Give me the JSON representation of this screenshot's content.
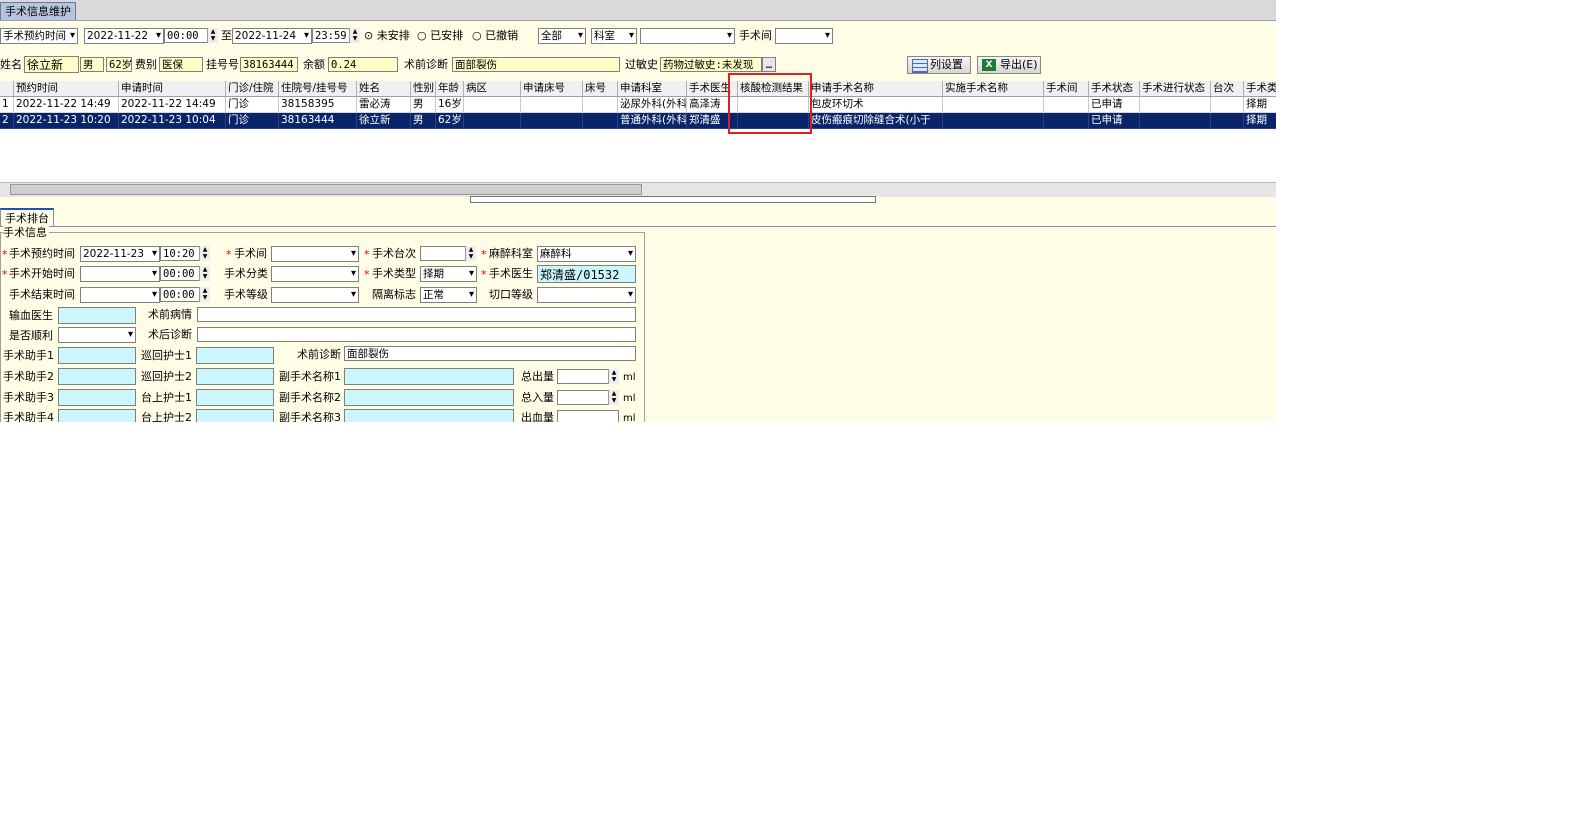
{
  "window": {
    "tab_title": "手术信息维护"
  },
  "filter": {
    "date_type": "手术预约时间",
    "start_date": "2022-11-22",
    "start_time": "00:00",
    "to_label": "至",
    "end_date": "2022-11-24",
    "end_time": "23:59",
    "radio_unscheduled": "未安排",
    "radio_scheduled": "已安排",
    "radio_cancelled": "已撤销",
    "scope": "全部",
    "dept_type": "科室",
    "dept_value": "",
    "room_label": "手术间",
    "room_value": ""
  },
  "patient": {
    "name_label": "姓名",
    "name": "徐立新",
    "gender": "男",
    "age": "62岁",
    "fee_type_label": "费别",
    "fee_type": "医保",
    "reg_no_label": "挂号号",
    "reg_no": "38163444",
    "balance_label": "余额",
    "balance": "0.24",
    "preop_dx_label": "术前诊断",
    "preop_dx": "面部裂伤",
    "allergy_label": "过敏史",
    "allergy": "药物过敏史:未发现"
  },
  "toolbar": {
    "columns_btn": "列设置",
    "export_btn": "导出(E)"
  },
  "grid": {
    "columns": [
      "预约时间",
      "申请时间",
      "门诊/住院",
      "住院号/挂号号",
      "姓名",
      "性别",
      "年龄",
      "病区",
      "申请床号",
      "床号",
      "申请科室",
      "手术医生",
      "核酸检测结果",
      "申请手术名称",
      "实施手术名称",
      "手术间",
      "手术状态",
      "手术进行状态",
      "台次",
      "手术类"
    ],
    "rows": [
      {
        "no": "1",
        "cells": [
          "2022-11-22 14:49",
          "2022-11-22 14:49",
          "门诊",
          "38158395",
          "雷必涛",
          "男",
          "16岁",
          "",
          "",
          "",
          "泌尿外科(外科",
          "高泽涛",
          "",
          "包皮环切术",
          "",
          "",
          "已申请",
          "",
          "",
          "择期"
        ]
      },
      {
        "no": "2",
        "cells": [
          "2022-11-23 10:20",
          "2022-11-23 10:04",
          "门诊",
          "38163444",
          "徐立新",
          "男",
          "62岁",
          "",
          "",
          "",
          "普通外科(外科",
          "郑清盛",
          "",
          "皮伤瘢痕切除缝合术(小于",
          "",
          "",
          "已申请",
          "",
          "",
          "择期"
        ]
      }
    ]
  },
  "detail": {
    "tab": "手术排台",
    "group": "手术信息",
    "appt_time_label": "手术预约时间",
    "appt_date": "2022-11-23",
    "appt_time": "10:20",
    "room_label": "手术间",
    "room": "",
    "seq_label": "手术台次",
    "seq": "",
    "anes_dept_label": "麻醉科室",
    "anes_dept": "麻醉科",
    "start_time_label": "手术开始时间",
    "start_date": "",
    "start_time": "00:00",
    "category_label": "手术分类",
    "category": "",
    "type_label": "手术类型",
    "type": "择期",
    "surgeon_label": "手术医生",
    "surgeon": "郑清盛/01532",
    "end_time_label": "手术结束时间",
    "end_date": "",
    "end_time": "00:00",
    "grade_label": "手术等级",
    "grade": "",
    "isolation_label": "隔离标志",
    "isolation": "正常",
    "incision_label": "切口等级",
    "incision": "",
    "transfusion_doc_label": "输血医生",
    "preop_condition_label": "术前病情",
    "smooth_label": "是否顺利",
    "postop_dx_label": "术后诊断",
    "assist1_label": "手术助手1",
    "circ_nurse1_label": "巡回护士1",
    "preop_dx_label": "术前诊断",
    "preop_dx": "面部裂伤",
    "assist2_label": "手术助手2",
    "circ_nurse2_label": "巡回护士2",
    "sub_op1_label": "副手术名称1",
    "total_out_label": "总出量",
    "assist3_label": "手术助手3",
    "scrub_nurse1_label": "台上护士1",
    "sub_op2_label": "副手术名称2",
    "total_in_label": "总入量",
    "assist4_label": "手术助手4",
    "scrub_nurse2_label": "台上护士2",
    "sub_op3_label": "副手术名称3",
    "blood_loss_label": "出血量",
    "unit_ml": "ml"
  }
}
